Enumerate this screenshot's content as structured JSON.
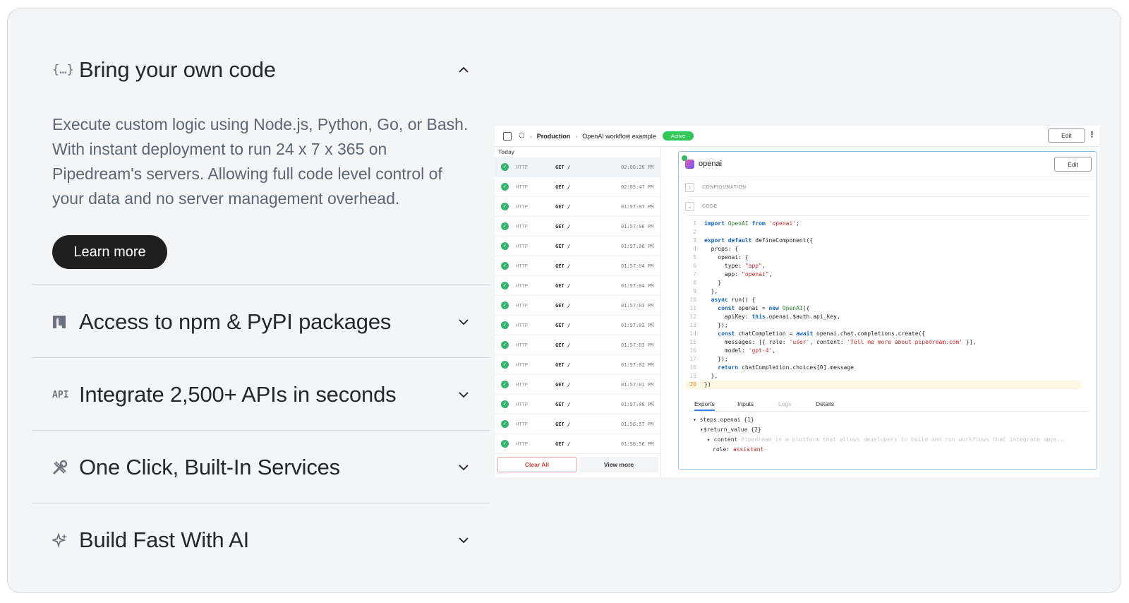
{
  "accordion": {
    "open_item": {
      "icon": "{…}",
      "title": "Bring your own code",
      "description": "Execute custom logic using Node.js, Python, Go, or Bash. With instant deployment to run 24 x 7 x 365 on Pipedream's servers. Allowing full code level control of your data and no server management overhead.",
      "button": "Learn more"
    },
    "items": [
      {
        "icon": "npm-icon",
        "title": "Access to npm & PyPI packages"
      },
      {
        "icon": "api-icon",
        "icon_text": "API",
        "title": "Integrate 2,500+ APIs in seconds"
      },
      {
        "icon": "tools-icon",
        "title": "One Click, Built-In Services"
      },
      {
        "icon": "sparkle-icon",
        "title": "Build Fast With AI"
      }
    ]
  },
  "preview": {
    "breadcrumb": [
      "Production",
      "OpenAI workflow example"
    ],
    "status": "Active",
    "edit_label": "Edit",
    "events": {
      "day": "Today",
      "rows": [
        {
          "type": "HTTP",
          "method": "GET /",
          "time": "02:06:20 PM"
        },
        {
          "type": "HTTP",
          "method": "GET /",
          "time": "02:05:47 PM"
        },
        {
          "type": "HTTP",
          "method": "GET /",
          "time": "01:57:07 PM"
        },
        {
          "type": "HTTP",
          "method": "GET /",
          "time": "01:57:06 PM"
        },
        {
          "type": "HTTP",
          "method": "GET /",
          "time": "01:57:06 PM"
        },
        {
          "type": "HTTP",
          "method": "GET /",
          "time": "01:57:04 PM"
        },
        {
          "type": "HTTP",
          "method": "GET /",
          "time": "01:57:04 PM"
        },
        {
          "type": "HTTP",
          "method": "GET /",
          "time": "01:57:03 PM"
        },
        {
          "type": "HTTP",
          "method": "GET /",
          "time": "01:57:03 PM"
        },
        {
          "type": "HTTP",
          "method": "GET /",
          "time": "01:57:03 PM"
        },
        {
          "type": "HTTP",
          "method": "GET /",
          "time": "01:57:02 PM"
        },
        {
          "type": "HTTP",
          "method": "GET /",
          "time": "01:57:01 PM"
        },
        {
          "type": "HTTP",
          "method": "GET /",
          "time": "01:57:00 PM"
        },
        {
          "type": "HTTP",
          "method": "GET /",
          "time": "01:56:57 PM"
        },
        {
          "type": "HTTP",
          "method": "GET /",
          "time": "01:56:56 PM"
        }
      ],
      "clear_label": "Clear All",
      "more_label": "View more"
    },
    "step": {
      "name": "openai",
      "edit_label": "Edit",
      "configuration_label": "CONFIGURATION",
      "code_label": "CODE",
      "code_lines": [
        "import OpenAI from 'openai';",
        "",
        "export default defineComponent({",
        "  props: {",
        "    openai: {",
        "      type: \"app\",",
        "      app: \"openai\",",
        "    }",
        "  },",
        "  async run() {",
        "    const openai = new OpenAI({",
        "      apiKey: this.openai.$auth.api_key,",
        "    });",
        "    const chatCompletion = await openai.chat.completions.create({",
        "      messages: [{ role: 'user', content: 'Tell me more about pipedream.com' }],",
        "      model: 'gpt-4',",
        "    });",
        "    return chatCompletion.choices[0].message",
        "  },",
        "})"
      ],
      "tabs": [
        "Exports",
        "Inputs",
        "Logs",
        "Details"
      ],
      "exports": {
        "root": "steps.openai {1}",
        "return_value": "$return_value {2}",
        "content_key": "content",
        "content_value": "Pipedream is a platform that allows developers to build and run workflows that integrate apps,…",
        "role_key": "role:",
        "role_value": "assistant"
      }
    }
  }
}
